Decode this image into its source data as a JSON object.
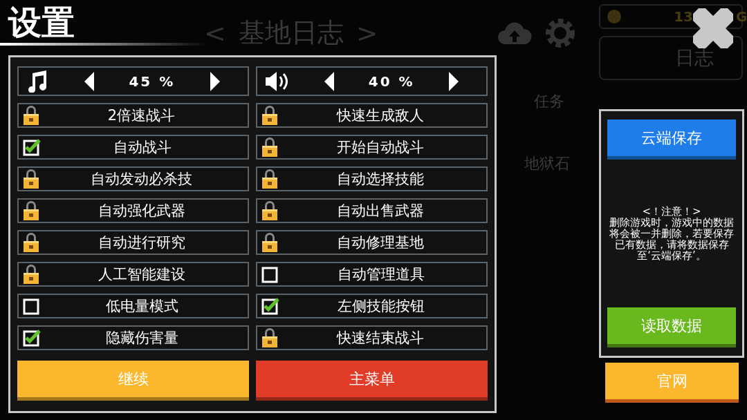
{
  "title": "设置",
  "background": {
    "prev": "<",
    "header": "基地日志",
    "next": ">",
    "coins": "13",
    "currency": "G",
    "side_item": "日志",
    "items": [
      "任务",
      "地狱石"
    ]
  },
  "volumes": [
    {
      "kind": "music",
      "value": "45 %"
    },
    {
      "kind": "sound",
      "value": "40 %"
    }
  ],
  "options": [
    {
      "label": "2倍速战斗",
      "kind": "locked"
    },
    {
      "label": "快速生成敌人",
      "kind": "locked"
    },
    {
      "label": "自动战斗",
      "kind": "checkbox",
      "checked": true
    },
    {
      "label": "开始自动战斗",
      "kind": "locked"
    },
    {
      "label": "自动发动必杀技",
      "kind": "locked"
    },
    {
      "label": "自动选择技能",
      "kind": "locked"
    },
    {
      "label": "自动强化武器",
      "kind": "locked"
    },
    {
      "label": "自动出售武器",
      "kind": "locked"
    },
    {
      "label": "自动进行研究",
      "kind": "locked"
    },
    {
      "label": "自动修理基地",
      "kind": "locked"
    },
    {
      "label": "人工智能建设",
      "kind": "locked"
    },
    {
      "label": "自动管理道具",
      "kind": "checkbox",
      "checked": false
    },
    {
      "label": "低电量模式",
      "kind": "checkbox",
      "checked": false
    },
    {
      "label": "左侧技能按钮",
      "kind": "checkbox",
      "checked": true
    },
    {
      "label": "隐藏伤害量",
      "kind": "checkbox",
      "checked": true
    },
    {
      "label": "快速结束战斗",
      "kind": "locked"
    }
  ],
  "buttons": [
    {
      "label": "继续",
      "color": "#fbb72e"
    },
    {
      "label": "主菜单",
      "color": "#e03c28"
    }
  ],
  "cloud": {
    "save": "云端保存",
    "notice_title": "<！注意！>",
    "notice": "删除游戏时，游戏中的数据将会被一并删除，若要保存已有数据，请将数据保存至‘云端保存’。",
    "load": "读取数据"
  },
  "website": "官网"
}
